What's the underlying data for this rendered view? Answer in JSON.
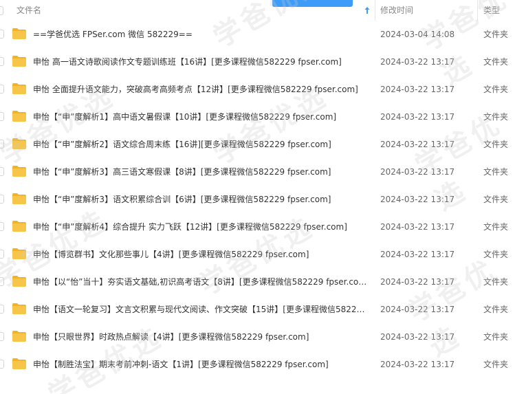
{
  "header": {
    "name_label": "文件名",
    "date_label": "修改时间",
    "type_label": "类型",
    "sort_icon": "sort-ascending-arrow-icon"
  },
  "watermark_text": "学爸优选",
  "colors": {
    "folder": "#f7c548",
    "folder_dark": "#f0b32e",
    "accent": "#3c9cf7"
  },
  "rows": [
    {
      "name": "==学爸优选 FPSer.com 微信 582229==",
      "date": "2024-03-04 14:08",
      "type": "文件夹"
    },
    {
      "name": "申怡 高一语文诗歌阅读作文专题训练班【16讲】[更多课程微信582229 fpser.com]",
      "date": "2024-03-22 13:17",
      "type": "文件夹"
    },
    {
      "name": "申怡 全面提升语文能力，突破高考高频考点【12讲】[更多课程微信582229 fpser.com]",
      "date": "2024-03-22 13:17",
      "type": "文件夹"
    },
    {
      "name": "申怡【“申”度解析1】高中语文暑假课【10讲】[更多课程微信582229 fpser.com]",
      "date": "2024-03-22 13:17",
      "type": "文件夹"
    },
    {
      "name": "申怡【“申”度解析2】语文综合周末练【16讲][更多课程微信582229 fpser.com]",
      "date": "2024-03-22 13:17",
      "type": "文件夹"
    },
    {
      "name": "申怡【“申”度解析3】高三语文寒假课【8讲】[更多课程微信582229 fpser.com]",
      "date": "2024-03-22 13:17",
      "type": "文件夹"
    },
    {
      "name": "申怡【“申”度解析3】语文积累综合训【6讲】[更多课程微信582229 fpser.com]",
      "date": "2024-03-22 13:17",
      "type": "文件夹"
    },
    {
      "name": "申怡【“申”度解析4】综合提升 实力飞跃【12讲】[更多课程微信582229 fpser.com]",
      "date": "2024-03-22 13:17",
      "type": "文件夹"
    },
    {
      "name": "申怡【博览群书】文化那些事儿【4讲】[更多课程微信582229 fpser.com]",
      "date": "2024-03-22 13:17",
      "type": "文件夹"
    },
    {
      "name": "申怡【以“怡”当十】夯实语文基础,初识高考语文【8讲】[更多课程微信582229 fpser.com]",
      "date": "2024-03-22 13:17",
      "type": "文件夹"
    },
    {
      "name": "申怡【语文一轮复习】文言文积累与现代文阅读、作文突破【15讲】[更多课程微信58222...",
      "date": "2024-03-22 13:17",
      "type": "文件夹"
    },
    {
      "name": "申怡【只眼世界】时政热点解读【4讲】[更多课程微信582229 fpser.com]",
      "date": "2024-03-22 13:17",
      "type": "文件夹"
    },
    {
      "name": "申怡【制胜法宝】期末考前冲刺-语文【1讲】[更多课程微信582229 fpser.com]",
      "date": "2024-03-22 13:17",
      "type": "文件夹"
    }
  ]
}
